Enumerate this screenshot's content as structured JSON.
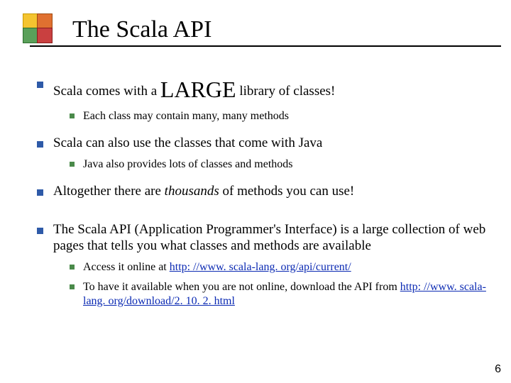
{
  "title": "The Scala API",
  "bullets": {
    "p1_pre": "Scala comes with a ",
    "p1_large": "LARGE",
    "p1_post": " library of classes!",
    "p1_sub1": "Each class may contain many, many methods",
    "p2": "Scala can also use the classes that come with Java",
    "p2_sub1": "Java also provides lots of classes and methods",
    "p3_pre": "Altogether there are ",
    "p3_em": "thousands",
    "p3_post": " of methods you can use!",
    "p4": "The Scala API (Application Programmer's Interface) is a large collection of web pages that tells you what classes and methods are available",
    "p4_sub1_pre": "Access it online at ",
    "p4_sub1_link": "http: //www. scala-lang. org/api/current/",
    "p4_sub2_pre": "To have it available when you are not online, download the API from ",
    "p4_sub2_link": "http: //www. scala-lang. org/download/2. 10. 2. html"
  },
  "page_number": "6"
}
